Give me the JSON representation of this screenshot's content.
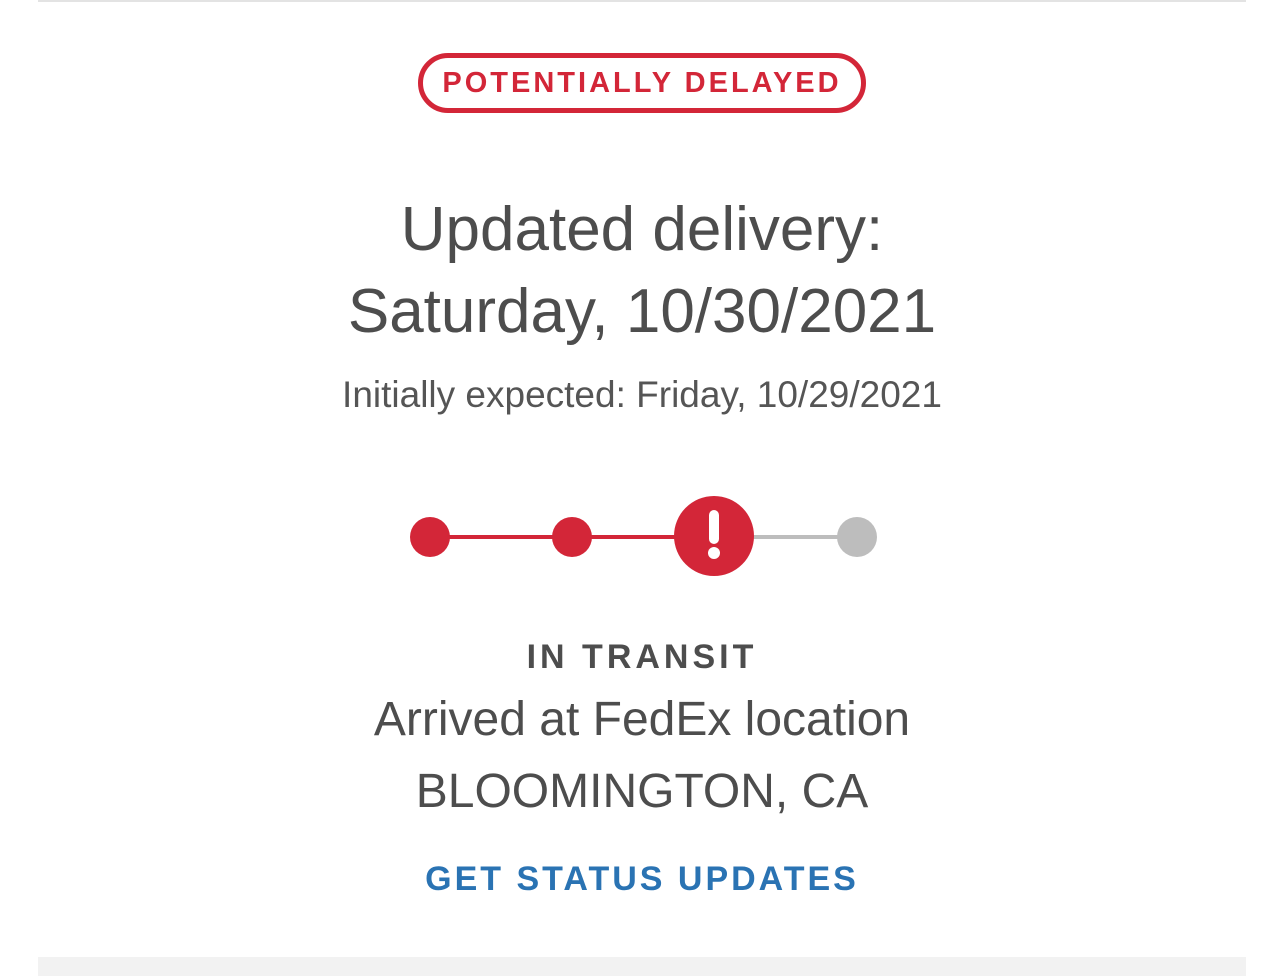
{
  "status_badge": {
    "label": "POTENTIALLY DELAYED",
    "color": "#d32638"
  },
  "delivery": {
    "heading_line1": "Updated delivery:",
    "heading_line2": "Saturday, 10/30/2021",
    "initially_expected": "Initially expected: Friday, 10/29/2021"
  },
  "progress": {
    "steps_total": 4,
    "current_step": 3,
    "current_step_icon": "exclamation-icon",
    "active_color": "#d32638",
    "inactive_color": "#bdbdbd"
  },
  "shipment_status": {
    "label": "IN TRANSIT",
    "detail_line1": "Arrived at FedEx location",
    "detail_line2": "BLOOMINGTON, CA"
  },
  "actions": {
    "get_updates_label": "GET STATUS UPDATES",
    "link_color": "#2a73b3"
  }
}
